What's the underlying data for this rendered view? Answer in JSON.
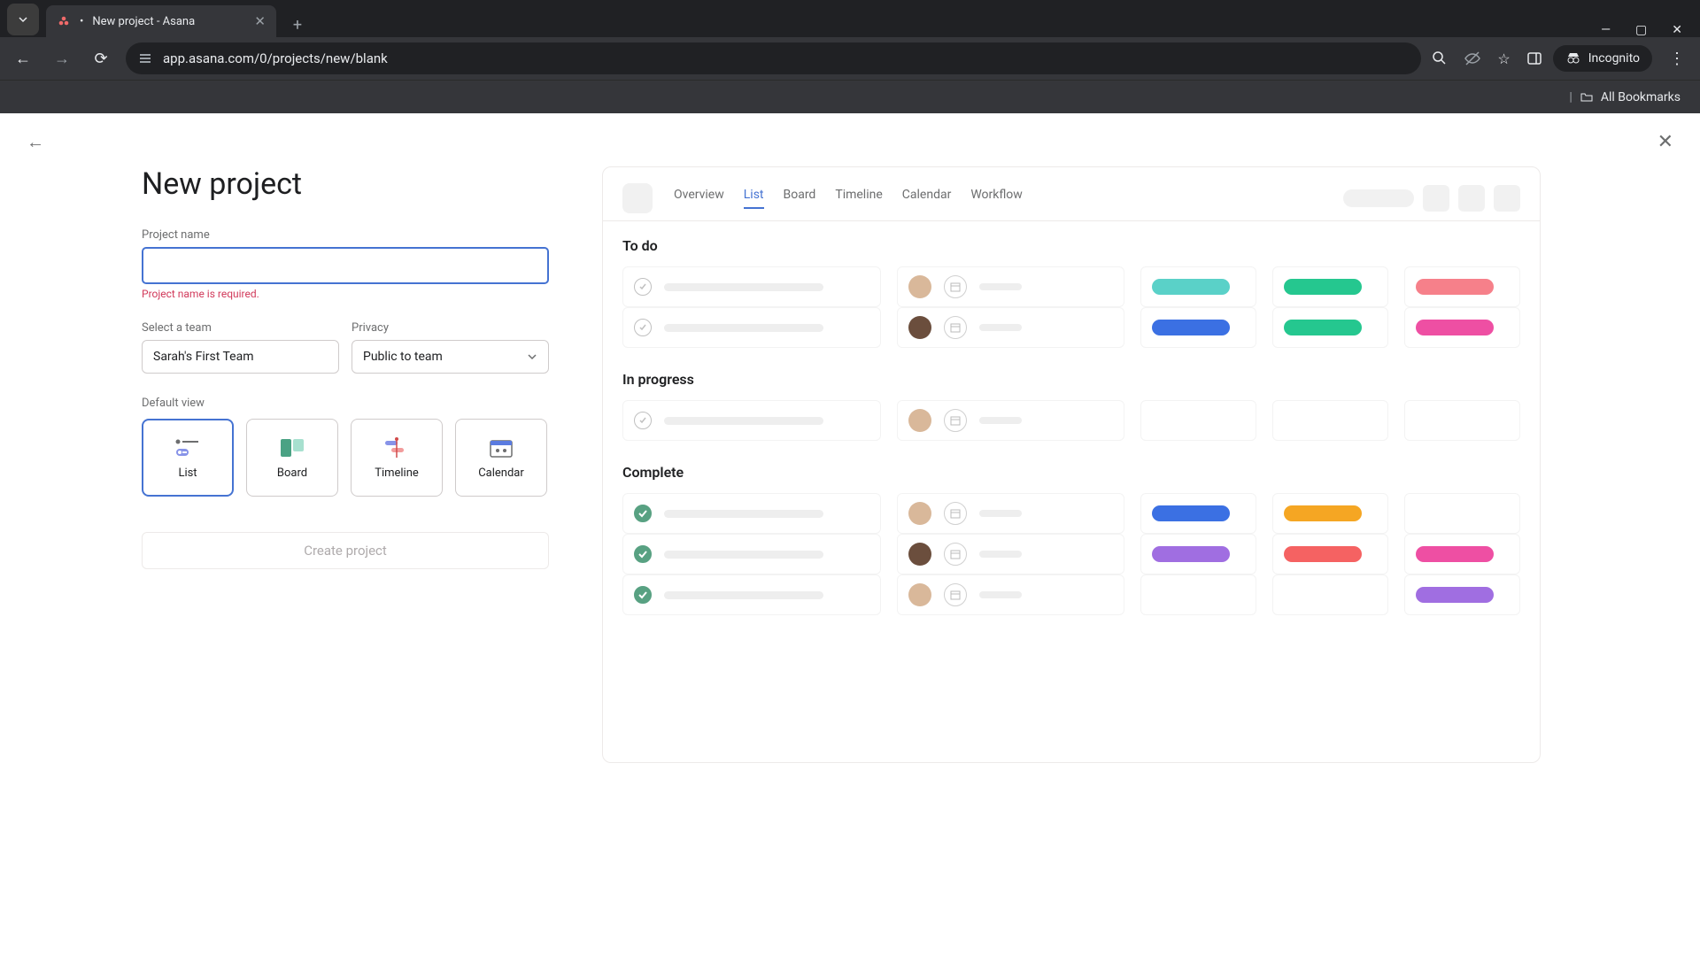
{
  "browser": {
    "tab_title": "New project - Asana",
    "url": "app.asana.com/0/projects/new/blank",
    "incognito_label": "Incognito",
    "all_bookmarks": "All Bookmarks"
  },
  "page": {
    "title": "New project",
    "project_name_label": "Project name",
    "project_name_value": "",
    "project_name_error": "Project name is required.",
    "team_label": "Select a team",
    "team_value": "Sarah's First Team",
    "privacy_label": "Privacy",
    "privacy_value": "Public to team",
    "default_view_label": "Default view",
    "views": [
      {
        "label": "List",
        "selected": true
      },
      {
        "label": "Board",
        "selected": false
      },
      {
        "label": "Timeline",
        "selected": false
      },
      {
        "label": "Calendar",
        "selected": false
      }
    ],
    "create_button": "Create project"
  },
  "preview": {
    "tabs": [
      "Overview",
      "List",
      "Board",
      "Timeline",
      "Calendar",
      "Workflow"
    ],
    "active_tab": "List",
    "sections": [
      {
        "title": "To do",
        "tasks": [
          {
            "done": false,
            "avatar": "#d9b89a",
            "pills": [
              "#5ad1c8",
              "#25c78f",
              "#f6808a"
            ]
          },
          {
            "done": false,
            "avatar": "#6b4e3d",
            "pills": [
              "#3b70e3",
              "#25c78f",
              "#ee4fa3"
            ]
          }
        ]
      },
      {
        "title": "In progress",
        "tasks": [
          {
            "done": false,
            "avatar": "#d9b89a",
            "pills": [
              "",
              "",
              ""
            ]
          }
        ]
      },
      {
        "title": "Complete",
        "tasks": [
          {
            "done": true,
            "avatar": "#d9b89a",
            "pills": [
              "#3b70e3",
              "#f5a623",
              ""
            ]
          },
          {
            "done": true,
            "avatar": "#6b4e3d",
            "pills": [
              "#a06ee1",
              "#f56262",
              "#ee4fa3"
            ]
          },
          {
            "done": true,
            "avatar": "#d9b89a",
            "pills": [
              "",
              "",
              "#a06ee1"
            ]
          }
        ]
      }
    ]
  }
}
